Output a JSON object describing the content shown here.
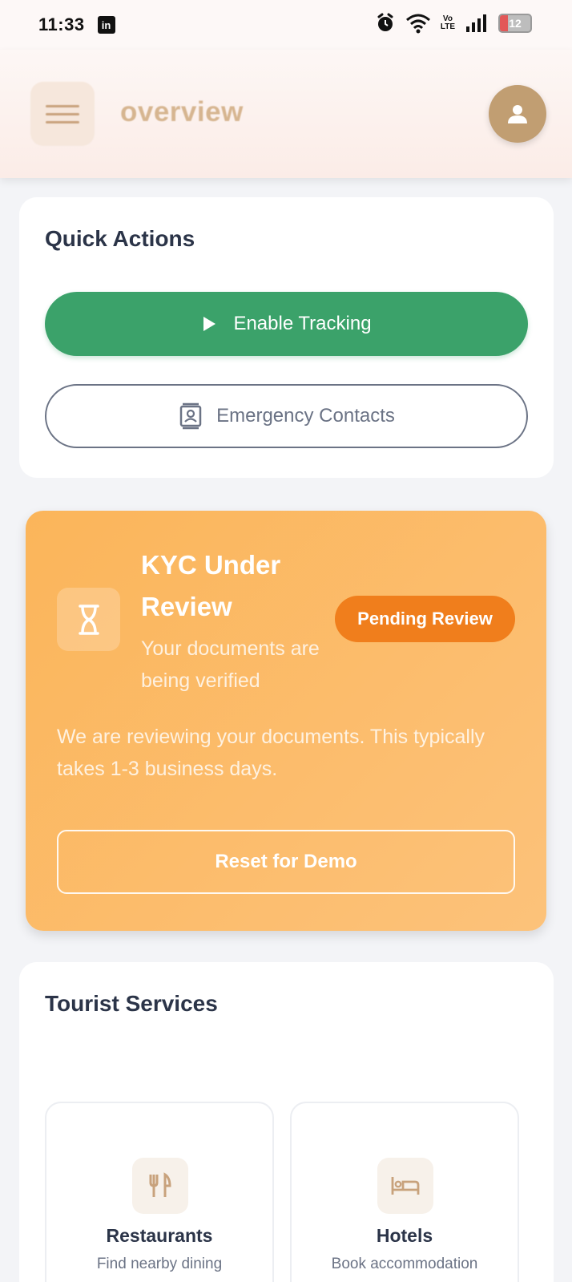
{
  "status_bar": {
    "time": "11:33",
    "linkedin_icon": "in",
    "battery": "12",
    "network": "Vo LTE"
  },
  "header": {
    "title": "overview"
  },
  "quick_actions": {
    "title": "Quick Actions",
    "enable_tracking": "Enable Tracking",
    "emergency_contacts": "Emergency Contacts"
  },
  "kyc": {
    "title": "KYC Under Review",
    "subtitle": "Your documents are being verified",
    "badge": "Pending Review",
    "description": "We are reviewing your documents. This typically takes 1-3 business days.",
    "reset_button": "Reset for Demo"
  },
  "tourist_services": {
    "title": "Tourist Services",
    "items": [
      {
        "name": "Restaurants",
        "desc": "Find nearby dining",
        "icon": "utensils-icon"
      },
      {
        "name": "Hotels",
        "desc": "Book accommodation",
        "icon": "bed-icon"
      }
    ]
  },
  "colors": {
    "accent_brown": "#c19e72",
    "green": "#3ba26a",
    "kyc_orange": "#fbb55a",
    "badge_orange": "#f07e1c"
  }
}
